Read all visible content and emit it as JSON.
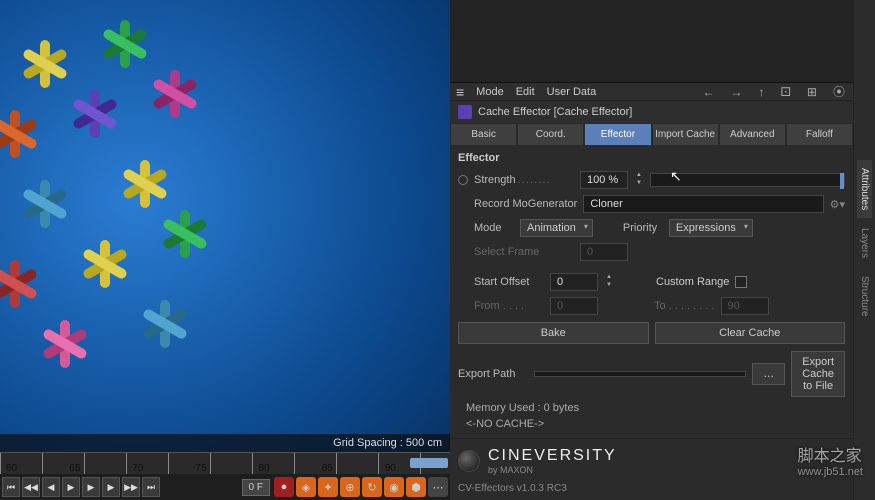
{
  "viewport": {
    "grid_spacing_label": "Grid Spacing : 500 cm"
  },
  "timeline": {
    "ticks": [
      "60",
      "65",
      "70",
      "75",
      "80",
      "85",
      "90"
    ],
    "frame_right": "0 F"
  },
  "side_tabs": [
    "Attributes",
    "Layers",
    "Structure"
  ],
  "attr_menu": {
    "mode": "Mode",
    "edit": "Edit",
    "user_data": "User Data"
  },
  "object_title": "Cache Effector [Cache Effector]",
  "tabs": [
    "Basic",
    "Coord.",
    "Effector",
    "Import Cache",
    "Advanced",
    "Falloff"
  ],
  "section_title": "Effector",
  "params": {
    "strength_label": "Strength",
    "strength_value": "100 %",
    "record_label": "Record MoGenerator",
    "record_value": "Cloner",
    "mode_label": "Mode",
    "mode_value": "Animation",
    "priority_label": "Priority",
    "priority_value": "Expressions",
    "select_frame_label": "Select Frame",
    "select_frame_value": "0",
    "start_offset_label": "Start Offset",
    "start_offset_value": "0",
    "custom_range_label": "Custom Range",
    "from_label": "From",
    "from_value": "0",
    "to_label": "To",
    "to_value": "90",
    "bake_label": "Bake",
    "clear_cache_label": "Clear Cache",
    "export_path_label": "Export Path",
    "export_path_value": "",
    "export_btn_label": "Export Cache to File",
    "memory_label": "Memory Used : 0 bytes",
    "no_cache_label": "<-NO CACHE->"
  },
  "branding": {
    "name": "CINEVERSITY",
    "byline": "by MAXON",
    "version": "CV-Effectors v1.0.3 RC3"
  },
  "watermark": {
    "line1": "脚本之家",
    "line2": "www.jb51.net"
  }
}
